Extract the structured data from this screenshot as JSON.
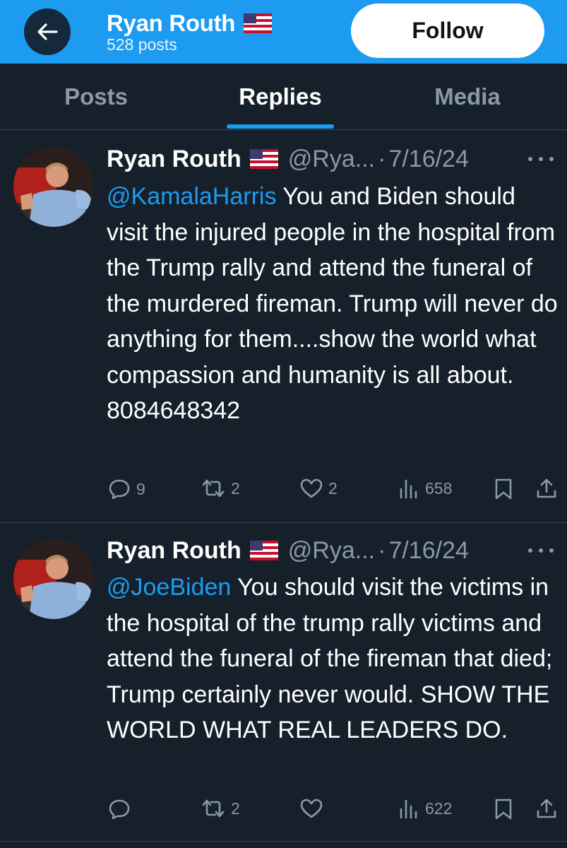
{
  "header": {
    "back_icon": "arrow-left-icon",
    "name": "Ryan Routh",
    "flag_icon": "us-flag-icon",
    "posts_count": "528 posts",
    "follow_label": "Follow",
    "colors": {
      "bar": "#1d9bf0",
      "background": "#15202b",
      "link": "#1d9bf0"
    }
  },
  "tabs": [
    {
      "label": "Posts",
      "active": false
    },
    {
      "label": "Replies",
      "active": true
    },
    {
      "label": "Media",
      "active": false
    }
  ],
  "posts": [
    {
      "name": "Ryan Routh",
      "handle": "@Rya...",
      "separator": "·",
      "date": "7/16/24",
      "mention": "@KamalaHarris",
      "text": " You and Biden should visit the injured people in the hospital from the Trump rally and attend the funeral of the murdered fireman. Trump will never do anything for them....show the world what compassion and humanity is all about. 8084648342",
      "replies": "9",
      "reposts": "2",
      "likes": "2",
      "views": "658"
    },
    {
      "name": "Ryan Routh",
      "handle": "@Rya...",
      "separator": "·",
      "date": "7/16/24",
      "mention": "@JoeBiden",
      "text": " You should visit the victims in the hospital of the trump rally victims and attend the funeral of the fireman that died; Trump certainly never would. SHOW THE WORLD WHAT REAL LEADERS DO.",
      "replies": "",
      "reposts": "2",
      "likes": "",
      "views": "622"
    }
  ]
}
